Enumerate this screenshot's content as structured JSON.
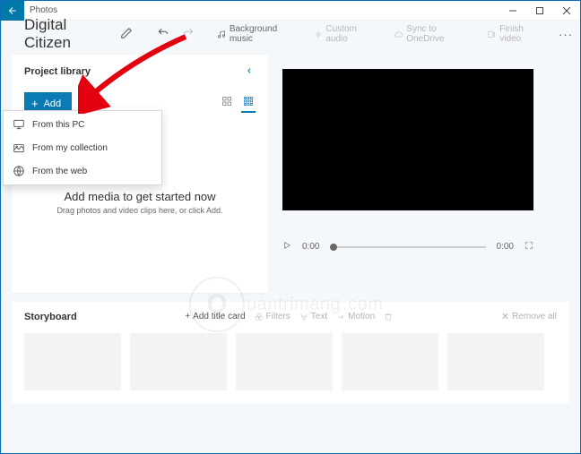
{
  "titlebar": {
    "app_name": "Photos"
  },
  "toolbar": {
    "project_title": "Digital Citizen",
    "bg_music": "Background music",
    "custom_audio": "Custom audio",
    "sync": "Sync to OneDrive",
    "finish": "Finish video"
  },
  "library": {
    "title": "Project library",
    "add_label": "Add",
    "empty_title": "Add media to get started now",
    "empty_sub": "Drag photos and video clips here, or click Add."
  },
  "dropdown": {
    "pc": "From this PC",
    "collection": "From my collection",
    "web": "From the web"
  },
  "player": {
    "time_start": "0:00",
    "time_end": "0:00"
  },
  "storyboard": {
    "title": "Storyboard",
    "add_title_card": "Add title card",
    "filters": "Filters",
    "text": "Text",
    "motion": "Motion",
    "remove_all": "Remove all"
  },
  "watermark": {
    "text": "uantrimang"
  }
}
